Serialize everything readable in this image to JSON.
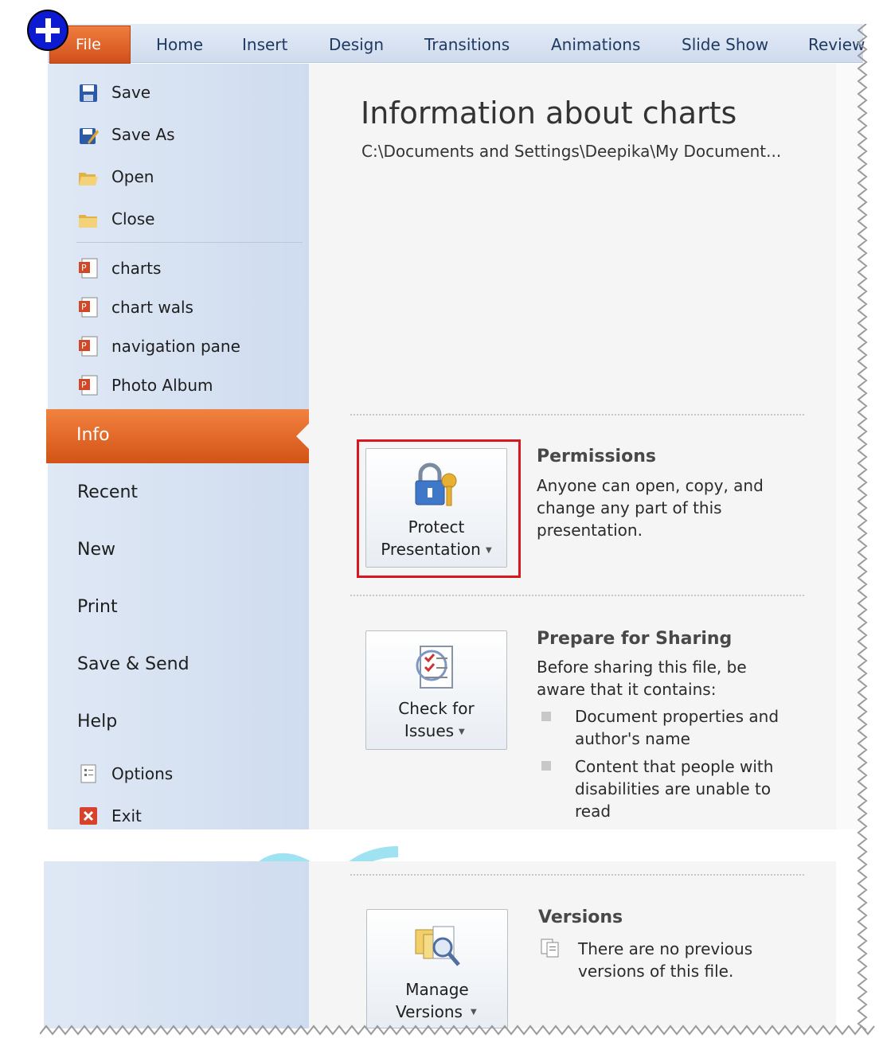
{
  "ribbon": {
    "tabs": [
      "File",
      "Home",
      "Insert",
      "Design",
      "Transitions",
      "Animations",
      "Slide Show",
      "Review"
    ]
  },
  "left_panel": {
    "commands": [
      "Save",
      "Save As",
      "Open",
      "Close"
    ],
    "recent_files": [
      "charts",
      "chart wals",
      "navigation pane",
      "Photo Album"
    ],
    "active_item": "Info",
    "nav_items": [
      "Recent",
      "New",
      "Print",
      "Save & Send",
      "Help"
    ],
    "bottom_commands": [
      "Options",
      "Exit"
    ]
  },
  "info": {
    "title": "Information about charts",
    "path": "C:\\Documents and Settings\\Deepika\\My Document..."
  },
  "permissions": {
    "button_line1": "Protect",
    "button_line2": "Presentation",
    "heading": "Permissions",
    "text": "Anyone can open, copy, and change any part of this presentation."
  },
  "sharing": {
    "button_line1": "Check for",
    "button_line2": "Issues",
    "heading": "Prepare for Sharing",
    "text": "Before sharing this file, be aware that it contains:",
    "bullets": [
      "Document properties and author's name",
      "Content that people with disabilities are unable to read"
    ]
  },
  "versions": {
    "button_line1": "Manage",
    "button_line2": "Versions",
    "heading": "Versions",
    "text": "There are no previous versions of this file."
  },
  "colors": {
    "accent": "#e3641f",
    "ribbon": "#d6e1f1",
    "highlight": "#d8181e"
  }
}
